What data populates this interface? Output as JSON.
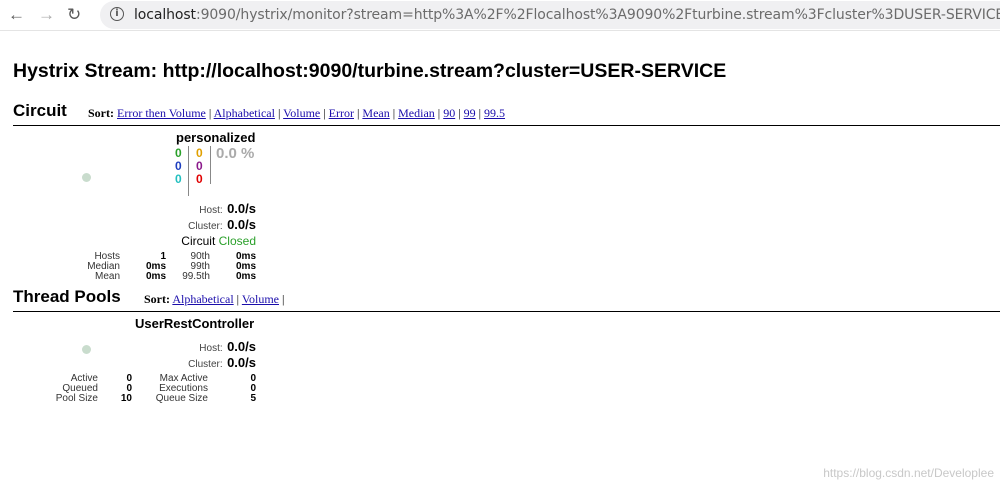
{
  "browser": {
    "url_host": "localhost",
    "url_rest": ":9090/hystrix/monitor?stream=http%3A%2F%2Flocalhost%3A9090%2Fturbine.stream%3Fcluster%3DUSER-SERVICE"
  },
  "page_title": "Hystrix Stream: http://localhost:9090/turbine.stream?cluster=USER-SERVICE",
  "circuit": {
    "heading": "Circuit",
    "sort_label": "Sort:",
    "sort_options": [
      "Error then Volume",
      "Alphabetical",
      "Volume",
      "Error",
      "Mean",
      "Median",
      "90",
      "99",
      "99.5"
    ],
    "name": "personalized",
    "counts_left": [
      "0",
      "0",
      "0"
    ],
    "counts_right": [
      "0",
      "0",
      "0"
    ],
    "error_pct": "0.0 %",
    "host_label": "Host:",
    "host_rate": "0.0/s",
    "cluster_label": "Cluster:",
    "cluster_rate": "0.0/s",
    "circuit_label": "Circuit",
    "circuit_status": "Closed",
    "stats": {
      "hosts_label": "Hosts",
      "hosts": "1",
      "median_label": "Median",
      "median": "0ms",
      "mean_label": "Mean",
      "mean": "0ms",
      "p90_label": "90th",
      "p90": "0ms",
      "p99_label": "99th",
      "p99": "0ms",
      "p995_label": "99.5th",
      "p995": "0ms"
    }
  },
  "thread_pools": {
    "heading": "Thread Pools",
    "sort_label": "Sort:",
    "sort_options": [
      "Alphabetical",
      "Volume"
    ],
    "name": "UserRestController",
    "host_label": "Host:",
    "host_rate": "0.0/s",
    "cluster_label": "Cluster:",
    "cluster_rate": "0.0/s",
    "stats": {
      "active_label": "Active",
      "active": "0",
      "queued_label": "Queued",
      "queued": "0",
      "pool_size_label": "Pool Size",
      "pool_size": "10",
      "max_active_label": "Max Active",
      "max_active": "0",
      "executions_label": "Executions",
      "executions": "0",
      "queue_size_label": "Queue Size",
      "queue_size": "5"
    }
  },
  "colors": {
    "link": "#1a0dab",
    "success": "#2aa02a",
    "short_circuited": "#1e3fbf",
    "bad_request": "#22bfbf",
    "timeout": "#e0a000",
    "rejected": "#8b1a8b",
    "failure": "#e00000",
    "indicator": "#c9dccd"
  },
  "watermark": "https://blog.csdn.net/Developlee"
}
